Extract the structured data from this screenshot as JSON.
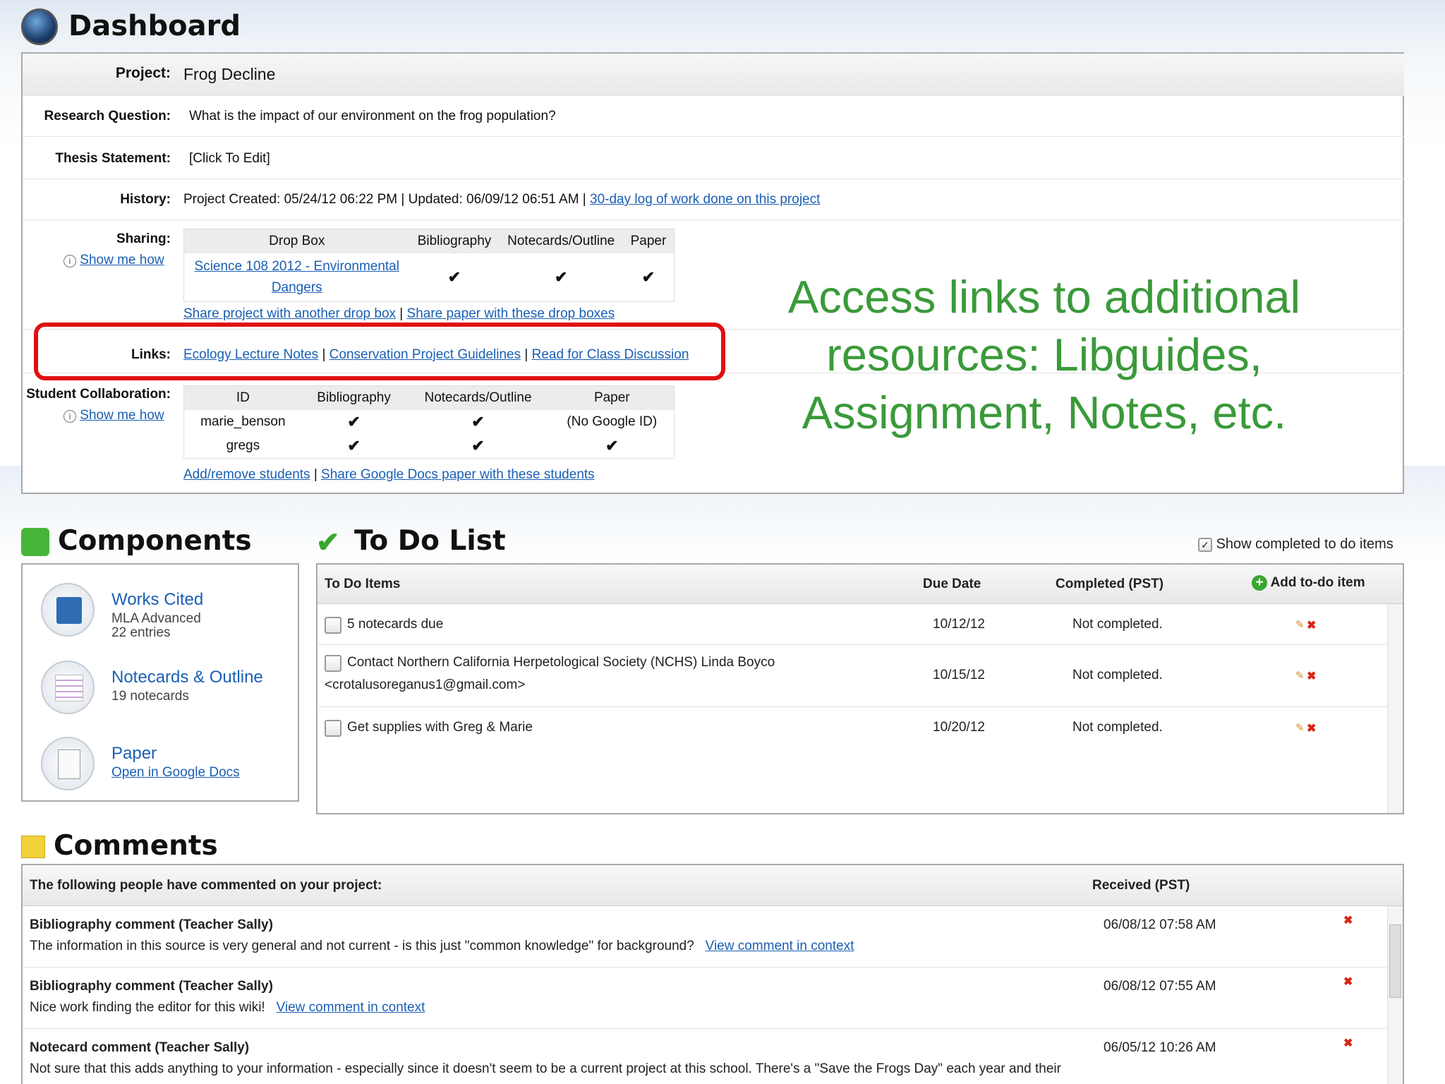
{
  "header": {
    "title": "Dashboard"
  },
  "project": {
    "project_label": "Project:",
    "project_value": "Frog Decline",
    "rq_label": "Research Question:",
    "rq_value": "What is the impact of our environment on the frog population?",
    "thesis_label": "Thesis Statement:",
    "thesis_value": "[Click To Edit]",
    "history_label": "History:",
    "history_value": "Project Created: 05/24/12 06:22 PM | Updated: 06/09/12 06:51 AM |",
    "history_link": "30-day log of work done on this project",
    "sharing_label": "Sharing:",
    "show_me_how": "Show me how",
    "sharing_headers": [
      "Drop Box",
      "Bibliography",
      "Notecards/Outline",
      "Paper"
    ],
    "dropbox_name": "Science 108 2012 - Environmental Dangers",
    "share_link1": "Share project with another drop box",
    "share_link2": "Share paper with these drop boxes",
    "links_label": "Links:",
    "links": [
      "Ecology Lecture Notes",
      "Conservation Project Guidelines",
      "Read for Class Discussion"
    ],
    "collab_label": "Student Collaboration:",
    "collab_headers": [
      "ID",
      "Bibliography",
      "Notecards/Outline",
      "Paper"
    ],
    "collab_rows": [
      {
        "id": "marie_benson",
        "paper": "(No Google ID)"
      },
      {
        "id": "gregs",
        "paper": ""
      }
    ],
    "collab_link1": "Add/remove students",
    "collab_link2": "Share Google Docs paper with these students",
    "sep": "|",
    "tick": "✔"
  },
  "callout": {
    "text": "Access links to additional resources: Libguides, Assignment, Notes, etc.",
    "color": "#3a9a3a",
    "box_color": "#e01010"
  },
  "components": {
    "title": "Components",
    "items": [
      {
        "name": "Works Cited",
        "sub1": "MLA Advanced",
        "sub2": "22 entries"
      },
      {
        "name": "Notecards & Outline",
        "sub1": "19 notecards",
        "sub2": ""
      },
      {
        "name": "Paper",
        "sub1": "",
        "link": "Open in Google Docs"
      }
    ]
  },
  "todo": {
    "title": "To Do List",
    "show_completed": "Show completed to do items",
    "headers": {
      "items": "To Do Items",
      "due": "Due Date",
      "completed": "Completed (PST)",
      "add": "Add to-do item"
    },
    "rows": [
      {
        "text": "5 notecards due",
        "text2": "",
        "due": "10/12/12",
        "status": "Not completed."
      },
      {
        "text": "Contact Northern California Herpetological Society (NCHS) Linda Boyco",
        "text2": "<crotalusoreganus1@gmail.com>",
        "due": "10/15/12",
        "status": "Not completed."
      },
      {
        "text": "Get supplies with Greg & Marie",
        "text2": "",
        "due": "10/20/12",
        "status": "Not completed."
      }
    ]
  },
  "comments": {
    "title": "Comments",
    "header_left": "The following people have commented on your project:",
    "header_right": "Received (PST)",
    "rows": [
      {
        "title": "Bibliography comment (Teacher Sally)",
        "body": "The information in this source is very general and not current - is this just \"common knowledge\" for background?",
        "link": "View comment in context",
        "date": "06/08/12 07:58 AM"
      },
      {
        "title": "Bibliography comment (Teacher Sally)",
        "body": "Nice work finding the editor for this wiki!",
        "link": "View comment in context",
        "date": "06/08/12 07:55 AM"
      },
      {
        "title": "Notecard comment (Teacher Sally)",
        "body": "Not sure that this adds anything to your information - especially since it doesn't seem to be a current project at this school. There's a \"Save the Frogs Day\" each year and their",
        "link": "",
        "date": "06/05/12 10:26 AM"
      }
    ]
  }
}
